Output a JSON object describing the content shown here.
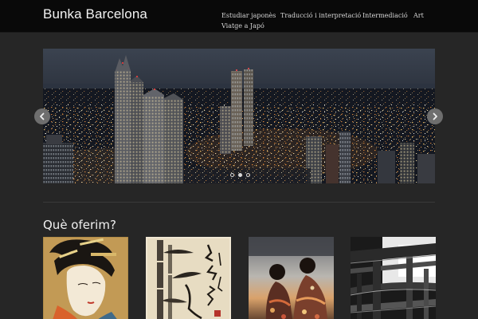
{
  "site": {
    "title": "Bunka Barcelona"
  },
  "nav": {
    "items": [
      {
        "label": "Estudiar japonès"
      },
      {
        "label": "Traducció i interpretació"
      },
      {
        "label": "Intermediació"
      },
      {
        "label": "Art"
      },
      {
        "label": "Viatge a Japó"
      }
    ]
  },
  "slider": {
    "slide_count": 3,
    "active_slide": 2
  },
  "services": {
    "heading": "Què oferim?"
  }
}
